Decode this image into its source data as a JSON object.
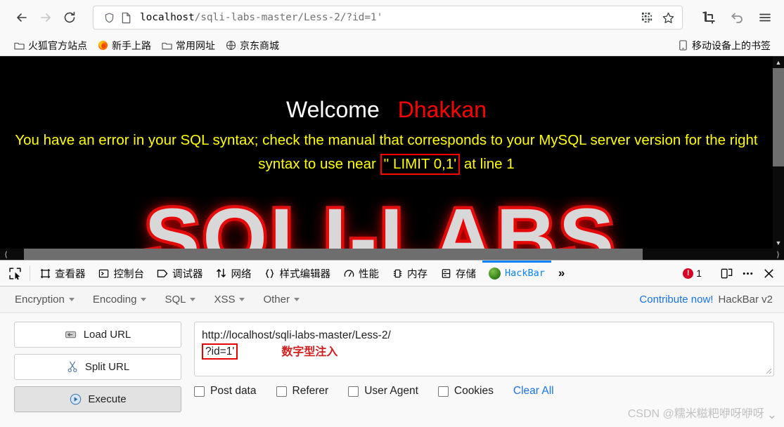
{
  "browser": {
    "nav": {
      "back": "back-arrow",
      "forward": "forward-arrow",
      "reload": "reload"
    },
    "url": {
      "host": "localhost",
      "path": "/sqli-labs-master/Less-2/?id=1'",
      "full": "localhost/sqli-labs-master/Less-2/?id=1'",
      "shield_icon": "shield-icon",
      "page_icon": "page-icon",
      "qr_icon": "qr-code-icon",
      "star_icon": "star-icon"
    },
    "toolbar_right": [
      {
        "name": "screenshot-icon",
        "label": ""
      },
      {
        "name": "undo-icon",
        "label": ""
      },
      {
        "name": "menu-icon",
        "label": ""
      }
    ],
    "bookmarks": [
      {
        "label": "火狐官方站点",
        "icon": "folder-icon"
      },
      {
        "label": "新手上路",
        "icon": "firefox-icon"
      },
      {
        "label": "常用网址",
        "icon": "folder-icon"
      },
      {
        "label": "京东商城",
        "icon": "globe-icon"
      }
    ],
    "bookmarks_right": {
      "label": "移动设备上的书签",
      "icon": "mobile-icon"
    }
  },
  "page": {
    "welcome_text": "Welcome",
    "welcome_name": "Dhakkan",
    "error_prefix": "You have an error in your SQL syntax; check the manual that corresponds to your MySQL server version for the right syntax to use near",
    "error_highlight": "'' LIMIT 0,1'",
    "error_suffix": "at line 1",
    "big_banner_text": "SQLI-LABS",
    "colors": {
      "background": "#000000",
      "welcome": "#ffffff",
      "name": "#ff0000",
      "error": "#ffff00",
      "highlight_border": "#ff0000"
    }
  },
  "devtools": {
    "picker_icon": "element-picker-icon",
    "tabs": [
      {
        "label": "查看器",
        "icon": "inspector-icon",
        "active": false
      },
      {
        "label": "控制台",
        "icon": "console-icon",
        "active": false
      },
      {
        "label": "调试器",
        "icon": "debugger-icon",
        "active": false
      },
      {
        "label": "网络",
        "icon": "network-icon",
        "active": false
      },
      {
        "label": "样式编辑器",
        "icon": "style-editor-icon",
        "active": false
      },
      {
        "label": "性能",
        "icon": "performance-icon",
        "active": false
      },
      {
        "label": "内存",
        "icon": "memory-icon",
        "active": false
      },
      {
        "label": "存储",
        "icon": "storage-icon",
        "active": false
      },
      {
        "label": "HackBar",
        "icon": "hackbar-icon",
        "active": true
      }
    ],
    "overflow_label": "»",
    "error_count": "1",
    "responsive_icon": "responsive-design-icon",
    "more_icon": "more-options-icon",
    "close_icon": "close-icon"
  },
  "hackbar": {
    "menus": [
      {
        "label": "Encryption"
      },
      {
        "label": "Encoding"
      },
      {
        "label": "SQL"
      },
      {
        "label": "XSS"
      },
      {
        "label": "Other"
      }
    ],
    "contribute_label": "Contribute now!",
    "version_label": "HackBar v2",
    "buttons": [
      {
        "label": "Load URL",
        "icon": "load-url-icon"
      },
      {
        "label": "Split URL",
        "icon": "scissors-icon"
      },
      {
        "label": "Execute",
        "icon": "play-icon"
      }
    ],
    "url_field": {
      "line1": "http://localhost/sqli-labs-master/Less-2/",
      "line2": "?id=1'",
      "annotation": "数字型注入"
    },
    "checkboxes": [
      {
        "label": "Post data",
        "checked": false
      },
      {
        "label": "Referer",
        "checked": false
      },
      {
        "label": "User Agent",
        "checked": false
      },
      {
        "label": "Cookies",
        "checked": false
      }
    ],
    "clear_all_label": "Clear All"
  },
  "watermark": {
    "text": "CSDN @糯米糍粑咿呀咿呀"
  }
}
